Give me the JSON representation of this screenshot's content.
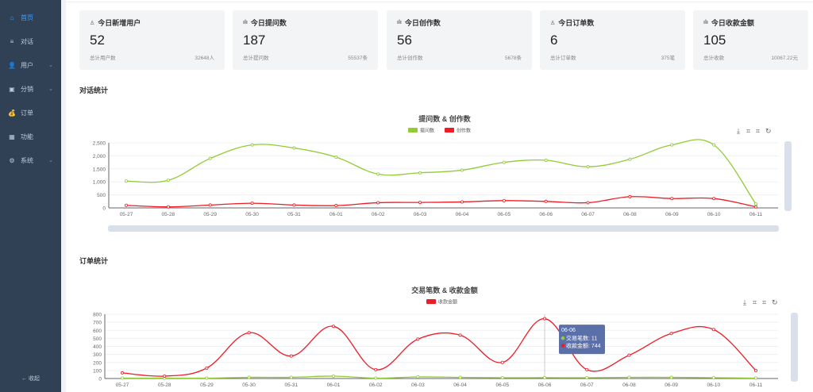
{
  "sidebar": {
    "items": [
      {
        "label": "首页",
        "icon": "home-icon",
        "glyph": "⌂",
        "active": true,
        "chev": false
      },
      {
        "label": "对话",
        "icon": "list-icon",
        "glyph": "≡",
        "chev": false
      },
      {
        "label": "用户",
        "icon": "user-icon",
        "glyph": "👤",
        "chev": true
      },
      {
        "label": "分销",
        "icon": "distribution-icon",
        "glyph": "▣",
        "chev": true
      },
      {
        "label": "订单",
        "icon": "money-bag-icon",
        "glyph": "💰",
        "chev": false
      },
      {
        "label": "功能",
        "icon": "grid-icon",
        "glyph": "▦",
        "chev": false
      },
      {
        "label": "系统",
        "icon": "gear-icon",
        "glyph": "⚙",
        "chev": true
      }
    ],
    "collapse_label": "← 收起"
  },
  "cards": [
    {
      "title": "今日新增用户",
      "icon": "user-icon",
      "glyph": "♙",
      "value": "52",
      "footer_label": "总计用户数",
      "footer_value": "32648人"
    },
    {
      "title": "今日提问数",
      "icon": "bar-chart-icon",
      "glyph": "ılı",
      "value": "187",
      "footer_label": "总计提问数",
      "footer_value": "55537条"
    },
    {
      "title": "今日创作数",
      "icon": "bar-chart-icon",
      "glyph": "ılı",
      "value": "56",
      "footer_label": "总计创作数",
      "footer_value": "5678条"
    },
    {
      "title": "今日订单数",
      "icon": "user-icon",
      "glyph": "♙",
      "value": "6",
      "footer_label": "总计订单数",
      "footer_value": "375笔"
    },
    {
      "title": "今日收款金额",
      "icon": "bar-chart-icon",
      "glyph": "ılı",
      "value": "105",
      "footer_label": "总计收款",
      "footer_value": "10067.22元"
    }
  ],
  "sections": {
    "chat": "对话统计",
    "order": "订单统计"
  },
  "colors": {
    "green": "#91cc34",
    "red": "#ee1c25",
    "sidebar": "#304156",
    "accent": "#409eff",
    "tooltip": "#5b6fa9"
  },
  "toolbox_icons": [
    "download-icon",
    "zoom-icon",
    "zoom-reset-icon",
    "restore-icon"
  ],
  "chart_data": [
    {
      "type": "line",
      "title": "提问数 & 创作数",
      "categories": [
        "05-27",
        "05-28",
        "05-29",
        "05-30",
        "05-31",
        "06-01",
        "06-02",
        "06-03",
        "06-04",
        "06-05",
        "06-06",
        "06-07",
        "06-08",
        "06-09",
        "06-10",
        "06-11"
      ],
      "ylim": [
        0,
        2500
      ],
      "yticks": [
        "0",
        "500",
        "1,000",
        "1,500",
        "2,000",
        "2,500"
      ],
      "grid": true,
      "legend": "top-center",
      "series": [
        {
          "name": "提问数",
          "color": "#91cc34",
          "legend": true,
          "values": [
            1030,
            1060,
            1900,
            2420,
            2300,
            1950,
            1300,
            1350,
            1450,
            1750,
            1830,
            1580,
            1870,
            2420,
            2420,
            150
          ]
        },
        {
          "name": "创作数",
          "color": "#ee1c25",
          "legend": true,
          "values": [
            100,
            40,
            110,
            180,
            110,
            90,
            200,
            210,
            230,
            280,
            250,
            200,
            430,
            360,
            360,
            40
          ]
        }
      ]
    },
    {
      "type": "line",
      "title": "交易笔数 & 收款金额",
      "categories": [
        "05-27",
        "05-28",
        "05-29",
        "05-30",
        "05-31",
        "06-01",
        "06-02",
        "06-03",
        "06-04",
        "06-05",
        "06-06",
        "06-07",
        "06-08",
        "06-09",
        "06-10",
        "06-11"
      ],
      "ylim": [
        0,
        800
      ],
      "yticks": [
        "0",
        "100",
        "200",
        "300",
        "400",
        "500",
        "600",
        "700",
        "800"
      ],
      "grid": true,
      "legend": "top-center",
      "series": [
        {
          "name": "交易笔数",
          "color": "#91cc34",
          "legend": false,
          "values": [
            5,
            5,
            5,
            15,
            15,
            30,
            5,
            20,
            15,
            10,
            11,
            10,
            15,
            15,
            10,
            5
          ]
        },
        {
          "name": "收款金额",
          "color": "#ee1c25",
          "legend": true,
          "values": [
            70,
            30,
            130,
            570,
            280,
            650,
            110,
            490,
            540,
            200,
            744,
            110,
            290,
            560,
            610,
            100
          ]
        }
      ],
      "tooltip": {
        "category": "06-06",
        "lines": [
          "交易笔数: 11",
          "收款金额: 744"
        ]
      }
    }
  ]
}
